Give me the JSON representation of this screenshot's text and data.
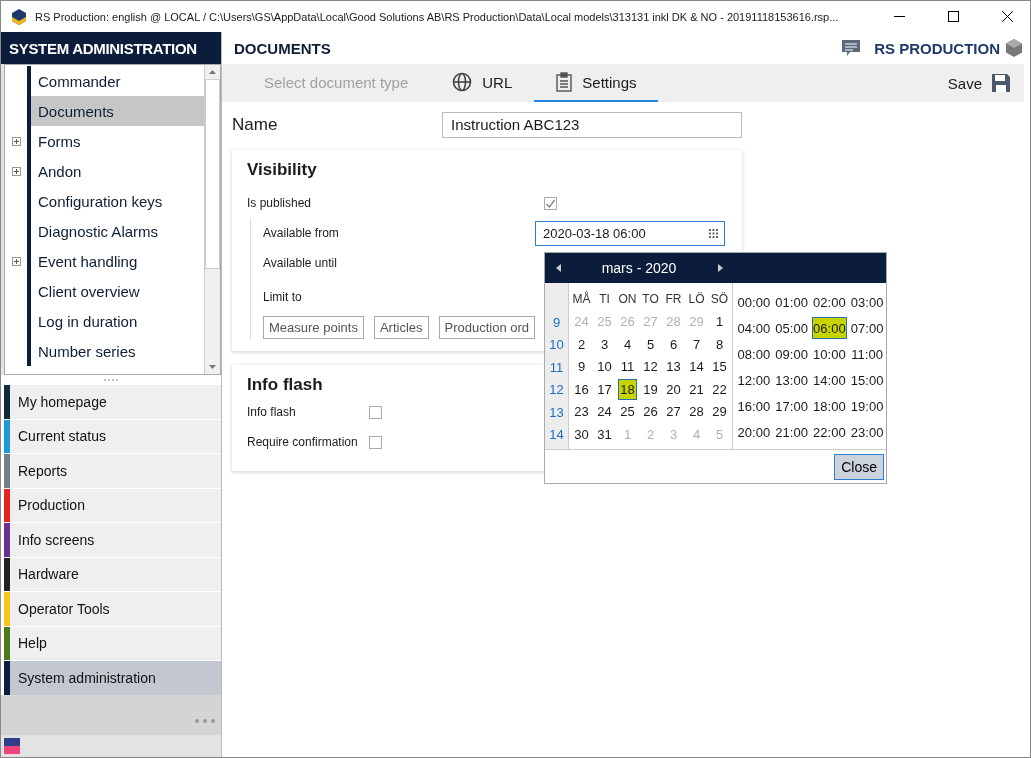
{
  "window": {
    "title": "RS Production: english @ LOCAL / C:\\Users\\GS\\AppData\\Local\\Good Solutions AB\\RS Production\\Data\\Local models\\313131 inkl DK & NO - 20191118153616.rsp..."
  },
  "sidebar": {
    "title": "SYSTEM ADMINISTRATION",
    "tree": [
      {
        "label": "Commander",
        "kind": "leaf",
        "selected": false
      },
      {
        "label": "Documents",
        "kind": "leaf",
        "selected": true
      },
      {
        "label": "Forms",
        "kind": "group",
        "selected": false
      },
      {
        "label": "Andon",
        "kind": "group",
        "selected": false
      },
      {
        "label": "Configuration keys",
        "kind": "leaf",
        "selected": false
      },
      {
        "label": "Diagnostic Alarms",
        "kind": "leaf",
        "selected": false
      },
      {
        "label": "Event handling",
        "kind": "group",
        "selected": false
      },
      {
        "label": "Client overview",
        "kind": "leaf",
        "selected": false
      },
      {
        "label": "Log in duration",
        "kind": "leaf",
        "selected": false
      },
      {
        "label": "Number series",
        "kind": "leaf",
        "selected": false
      }
    ],
    "modules": [
      {
        "label": "My homepage",
        "color": "#0f2c3a",
        "selected": false
      },
      {
        "label": "Current status",
        "color": "#1a9ad6",
        "selected": false
      },
      {
        "label": "Reports",
        "color": "#6f7f8c",
        "selected": false
      },
      {
        "label": "Production",
        "color": "#e8231f",
        "selected": false
      },
      {
        "label": "Info screens",
        "color": "#6a2f8f",
        "selected": false
      },
      {
        "label": "Hardware",
        "color": "#222222",
        "selected": false
      },
      {
        "label": "Operator Tools",
        "color": "#f5c518",
        "selected": false
      },
      {
        "label": "Help",
        "color": "#4a7a1a",
        "selected": false
      },
      {
        "label": "System administration",
        "color": "#0a1f40",
        "selected": true
      }
    ]
  },
  "header": {
    "title": "DOCUMENTS",
    "brand": "RS PRODUCTION"
  },
  "tabs": [
    {
      "label": "Select document type",
      "kind": "text",
      "selected": false,
      "disabled": true
    },
    {
      "label": "URL",
      "kind": "globe",
      "selected": false,
      "disabled": false
    },
    {
      "label": "Settings",
      "kind": "clipboard",
      "selected": true,
      "disabled": false
    }
  ],
  "save": "Save",
  "name_field": {
    "label": "Name",
    "value": "Instruction ABC123"
  },
  "visibility": {
    "title": "Visibility",
    "published_label": "Is published",
    "published": true,
    "from_label": "Available from",
    "from_value": "2020-03-18 06:00",
    "until_label": "Available until",
    "limit_label": "Limit to",
    "limit_buttons": [
      "Measure points",
      "Articles",
      "Production ord"
    ]
  },
  "info_flash": {
    "title": "Info flash",
    "rows": [
      {
        "label": "Info flash",
        "checked": false
      },
      {
        "label": "Require confirmation",
        "checked": false
      }
    ]
  },
  "date_picker": {
    "month": "mars - 2020",
    "weekdays": [
      "MÅ",
      "TI",
      "ON",
      "TO",
      "FR",
      "LÖ",
      "SÖ"
    ],
    "weeks": [
      {
        "number": "9",
        "days": [
          {
            "d": "24",
            "muted": true,
            "selected": false
          },
          {
            "d": "25",
            "muted": true,
            "selected": false
          },
          {
            "d": "26",
            "muted": true,
            "selected": false
          },
          {
            "d": "27",
            "muted": true,
            "selected": false
          },
          {
            "d": "28",
            "muted": true,
            "selected": false
          },
          {
            "d": "29",
            "muted": true,
            "selected": false
          },
          {
            "d": "1",
            "muted": false,
            "selected": false
          }
        ]
      },
      {
        "number": "10",
        "days": [
          {
            "d": "2",
            "muted": false,
            "selected": false
          },
          {
            "d": "3",
            "muted": false,
            "selected": false
          },
          {
            "d": "4",
            "muted": false,
            "selected": false
          },
          {
            "d": "5",
            "muted": false,
            "selected": false
          },
          {
            "d": "6",
            "muted": false,
            "selected": false
          },
          {
            "d": "7",
            "muted": false,
            "selected": false
          },
          {
            "d": "8",
            "muted": false,
            "selected": false
          }
        ]
      },
      {
        "number": "11",
        "days": [
          {
            "d": "9",
            "muted": false,
            "selected": false
          },
          {
            "d": "10",
            "muted": false,
            "selected": false
          },
          {
            "d": "11",
            "muted": false,
            "selected": false
          },
          {
            "d": "12",
            "muted": false,
            "selected": false
          },
          {
            "d": "13",
            "muted": false,
            "selected": false
          },
          {
            "d": "14",
            "muted": false,
            "selected": false
          },
          {
            "d": "15",
            "muted": false,
            "selected": false
          }
        ]
      },
      {
        "number": "12",
        "days": [
          {
            "d": "16",
            "muted": false,
            "selected": false
          },
          {
            "d": "17",
            "muted": false,
            "selected": false
          },
          {
            "d": "18",
            "muted": false,
            "selected": true
          },
          {
            "d": "19",
            "muted": false,
            "selected": false
          },
          {
            "d": "20",
            "muted": false,
            "selected": false
          },
          {
            "d": "21",
            "muted": false,
            "selected": false
          },
          {
            "d": "22",
            "muted": false,
            "selected": false
          }
        ]
      },
      {
        "number": "13",
        "days": [
          {
            "d": "23",
            "muted": false,
            "selected": false
          },
          {
            "d": "24",
            "muted": false,
            "selected": false
          },
          {
            "d": "25",
            "muted": false,
            "selected": false
          },
          {
            "d": "26",
            "muted": false,
            "selected": false
          },
          {
            "d": "27",
            "muted": false,
            "selected": false
          },
          {
            "d": "28",
            "muted": false,
            "selected": false
          },
          {
            "d": "29",
            "muted": false,
            "selected": false
          }
        ]
      },
      {
        "number": "14",
        "days": [
          {
            "d": "30",
            "muted": false,
            "selected": false
          },
          {
            "d": "31",
            "muted": false,
            "selected": false
          },
          {
            "d": "1",
            "muted": true,
            "selected": false
          },
          {
            "d": "2",
            "muted": true,
            "selected": false
          },
          {
            "d": "3",
            "muted": true,
            "selected": false
          },
          {
            "d": "4",
            "muted": true,
            "selected": false
          },
          {
            "d": "5",
            "muted": true,
            "selected": false
          }
        ]
      }
    ],
    "times": [
      {
        "t": "00:00",
        "selected": false
      },
      {
        "t": "01:00",
        "selected": false
      },
      {
        "t": "02:00",
        "selected": false
      },
      {
        "t": "03:00",
        "selected": false
      },
      {
        "t": "04:00",
        "selected": false
      },
      {
        "t": "05:00",
        "selected": false
      },
      {
        "t": "06:00",
        "selected": true
      },
      {
        "t": "07:00",
        "selected": false
      },
      {
        "t": "08:00",
        "selected": false
      },
      {
        "t": "09:00",
        "selected": false
      },
      {
        "t": "10:00",
        "selected": false
      },
      {
        "t": "11:00",
        "selected": false
      },
      {
        "t": "12:00",
        "selected": false
      },
      {
        "t": "13:00",
        "selected": false
      },
      {
        "t": "14:00",
        "selected": false
      },
      {
        "t": "15:00",
        "selected": false
      },
      {
        "t": "16:00",
        "selected": false
      },
      {
        "t": "17:00",
        "selected": false
      },
      {
        "t": "18:00",
        "selected": false
      },
      {
        "t": "19:00",
        "selected": false
      },
      {
        "t": "20:00",
        "selected": false
      },
      {
        "t": "21:00",
        "selected": false
      },
      {
        "t": "22:00",
        "selected": false
      },
      {
        "t": "23:00",
        "selected": false
      }
    ],
    "close": "Close"
  }
}
